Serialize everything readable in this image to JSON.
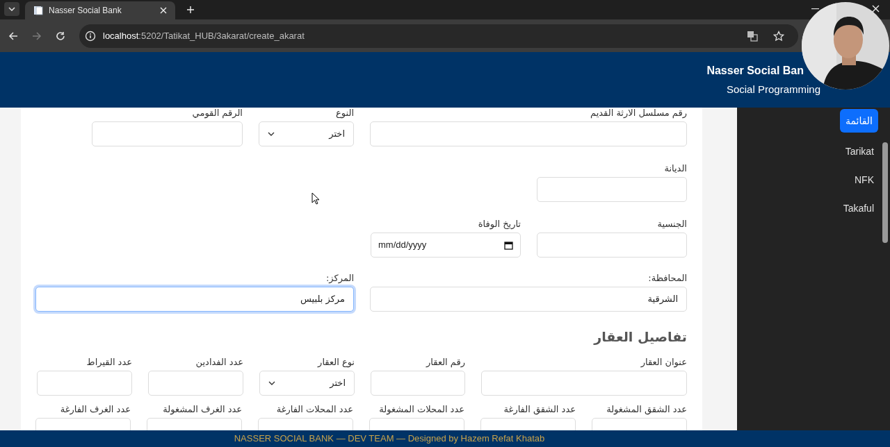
{
  "browser": {
    "tab_title": "Nasser Social Bank",
    "url_host": "localhost",
    "url_path": ":5202/Tatikat_HUB/3akarat/create_akarat"
  },
  "header": {
    "title": "Nasser Social Ban",
    "subtitle": "Social Programming"
  },
  "sidebar": {
    "items": [
      {
        "label": "القائمة",
        "selected": true
      },
      {
        "label": "Tarikat",
        "selected": false
      },
      {
        "label": "NFK",
        "selected": false
      },
      {
        "label": "Takaful",
        "selected": false
      }
    ]
  },
  "form": {
    "rows": [
      {
        "fields": [
          {
            "kind": "text",
            "label": "رقم مسلسل الارثة القديم"
          },
          {
            "kind": "select",
            "label": "النوع",
            "value": "اختر"
          },
          {
            "kind": "text",
            "label": "الرقم القومي"
          }
        ]
      },
      {
        "fields": [
          {
            "kind": "text",
            "label": "الديانة"
          }
        ]
      },
      {
        "fields": [
          {
            "kind": "text",
            "label": "الجنسية"
          },
          {
            "kind": "date",
            "label": "تاريخ الوفاة",
            "placeholder": "mm/dd/yyyy"
          }
        ]
      },
      {
        "fields": [
          {
            "kind": "text",
            "label": "المحافظة:",
            "value": "الشرقية",
            "focused": false
          },
          {
            "kind": "text",
            "label": "المركز:",
            "value": "مركز بلبيس",
            "focused": true
          }
        ]
      }
    ],
    "section_title": "تفاصيل العقار",
    "section_rows": [
      {
        "fields": [
          {
            "kind": "text",
            "label": "عنوان العقار"
          },
          {
            "kind": "text",
            "label": "رقم العقار"
          },
          {
            "kind": "select",
            "label": "نوع العقار",
            "value": "اختر"
          },
          {
            "kind": "text",
            "label": "عدد الفدادين"
          },
          {
            "kind": "text",
            "label": "عدد القيراط"
          }
        ]
      },
      {
        "fields": [
          {
            "kind": "text",
            "label": "عدد الشقق المشغولة"
          },
          {
            "kind": "text",
            "label": "عدد الشقق الفارغة"
          },
          {
            "kind": "text",
            "label": "عدد المحلات المشغولة"
          },
          {
            "kind": "text",
            "label": "عدد المحلات الفارغة"
          },
          {
            "kind": "text",
            "label": "عدد الغرف المشغولة"
          },
          {
            "kind": "text",
            "label": "عدد الغرف الفارغة"
          }
        ]
      }
    ]
  },
  "footer": {
    "text": "NASSER SOCIAL BANK — DEV TEAM — Designed by Hazem Refat Khatab"
  }
}
